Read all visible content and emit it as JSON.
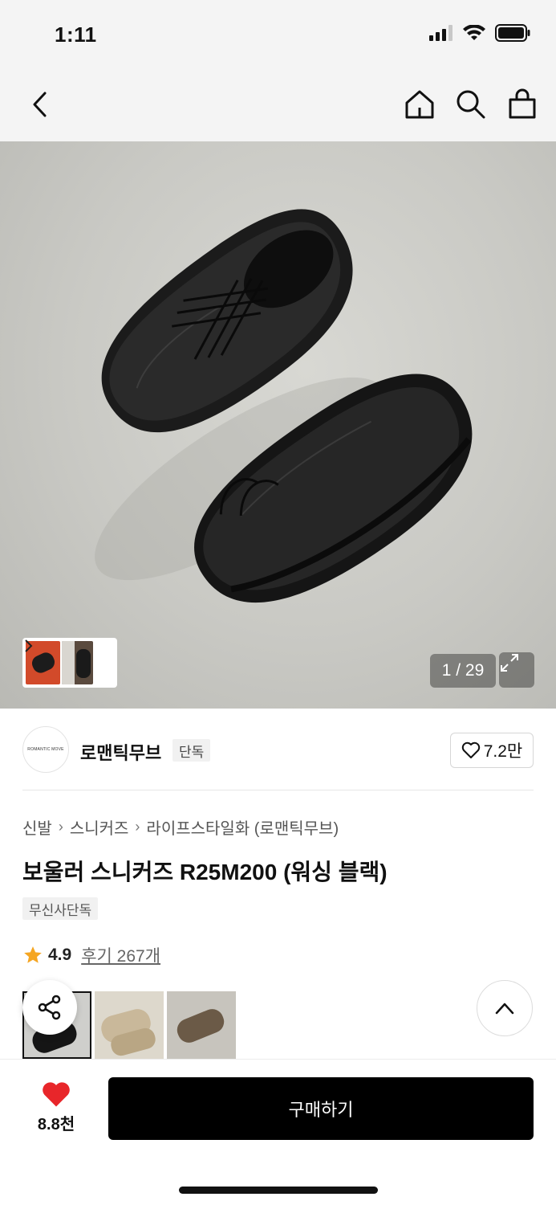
{
  "status": {
    "time": "1:11"
  },
  "nav": {
    "back_icon": "chevron-left-icon",
    "home_icon": "home-icon",
    "search_icon": "search-icon",
    "cart_icon": "shopping-bag-icon"
  },
  "gallery": {
    "counter": "1 / 29",
    "expand_icon": "expand-icon"
  },
  "brand": {
    "logo_text": "ROMANTIC MOVE",
    "name": "로맨틱무브",
    "tag": "단독",
    "likes": "7.2만"
  },
  "breadcrumb": [
    "신발",
    "스니커즈",
    "라이프스타일화 (로맨틱무브)"
  ],
  "product": {
    "title": "보울러 스니커즈 R25M200 (워싱 블랙)",
    "badge": "무신사단독",
    "rating": "4.9",
    "reviews": "후기 267개"
  },
  "bottom": {
    "wish_count": "8.8천",
    "buy_label": "구매하기"
  },
  "colors": {
    "accent": "#000000",
    "heart": "#e8262a",
    "star": "#f5a623"
  }
}
